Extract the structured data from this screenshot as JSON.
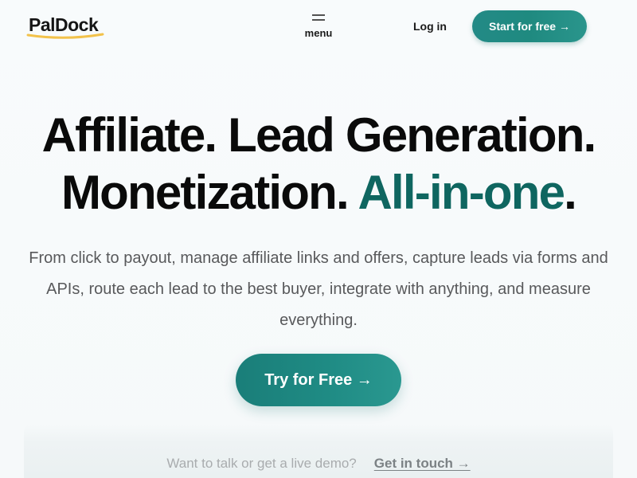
{
  "header": {
    "logo_text": "PalDock",
    "menu_label": "menu",
    "menu_icon": "hamburger-icon",
    "login_label": "Log in",
    "cta_label": "Start for free →"
  },
  "hero": {
    "headline_line1": "Affiliate. Lead Generation.",
    "headline_line2_main": "Monetization.",
    "headline_line2_accent": "All-in-one",
    "headline_line2_end": ".",
    "subtitle": "From click to payout, manage affiliate links and offers, capture leads via forms and APIs, route each lead to the best buyer, integrate with anything, and measure everything.",
    "cta_label": "Try for Free →"
  },
  "demo": {
    "prompt": "Want to talk or get a live demo?",
    "link_label": "Get in touch →"
  },
  "colors": {
    "accent": "#0f6660",
    "button_teal": "#1f8a80",
    "logo_underline": "#f2c24b",
    "background": "#f7fafb"
  }
}
